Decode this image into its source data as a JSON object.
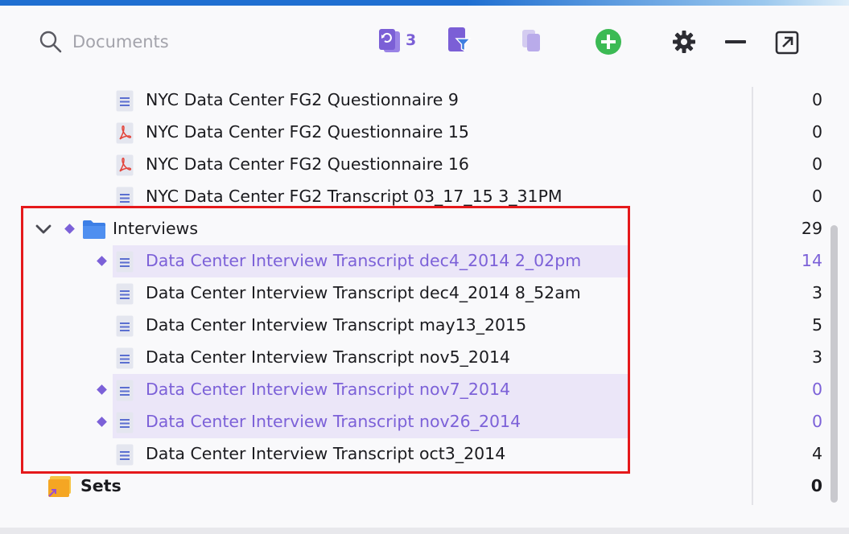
{
  "toolbar": {
    "search_placeholder": "Documents",
    "recent_count": "3"
  },
  "docs": [
    {
      "name": "NYC Data Center FG2 Questionnaire 9",
      "count": "0",
      "type": "text",
      "selected": false
    },
    {
      "name": "NYC Data Center FG2 Questionnaire 15",
      "count": "0",
      "type": "pdf",
      "selected": false
    },
    {
      "name": "NYC Data Center FG2 Questionnaire 16",
      "count": "0",
      "type": "pdf",
      "selected": false
    },
    {
      "name": "NYC Data Center FG2 Transcript 03_17_15 3_31PM",
      "count": "0",
      "type": "text",
      "selected": false
    }
  ],
  "group": {
    "name": "Interviews",
    "count": "29"
  },
  "interviews": [
    {
      "name": "Data Center Interview Transcript dec4_2014 2_02pm",
      "count": "14",
      "selected": true
    },
    {
      "name": "Data Center Interview Transcript dec4_2014 8_52am",
      "count": "3",
      "selected": false
    },
    {
      "name": "Data Center Interview Transcript may13_2015",
      "count": "5",
      "selected": false
    },
    {
      "name": "Data Center Interview Transcript nov5_2014",
      "count": "3",
      "selected": false
    },
    {
      "name": "Data Center Interview Transcript nov7_2014",
      "count": "0",
      "selected": true
    },
    {
      "name": "Data Center Interview Transcript nov26_2014",
      "count": "0",
      "selected": true
    },
    {
      "name": "Data Center Interview Transcript oct3_2014",
      "count": "4",
      "selected": false
    }
  ],
  "sets": {
    "name": "Sets",
    "count": "0"
  },
  "colors": {
    "accent": "#7c61d8",
    "highlight": "#ebe6f8",
    "annotation_box": "#e5191b",
    "add_button": "#3cba54"
  }
}
